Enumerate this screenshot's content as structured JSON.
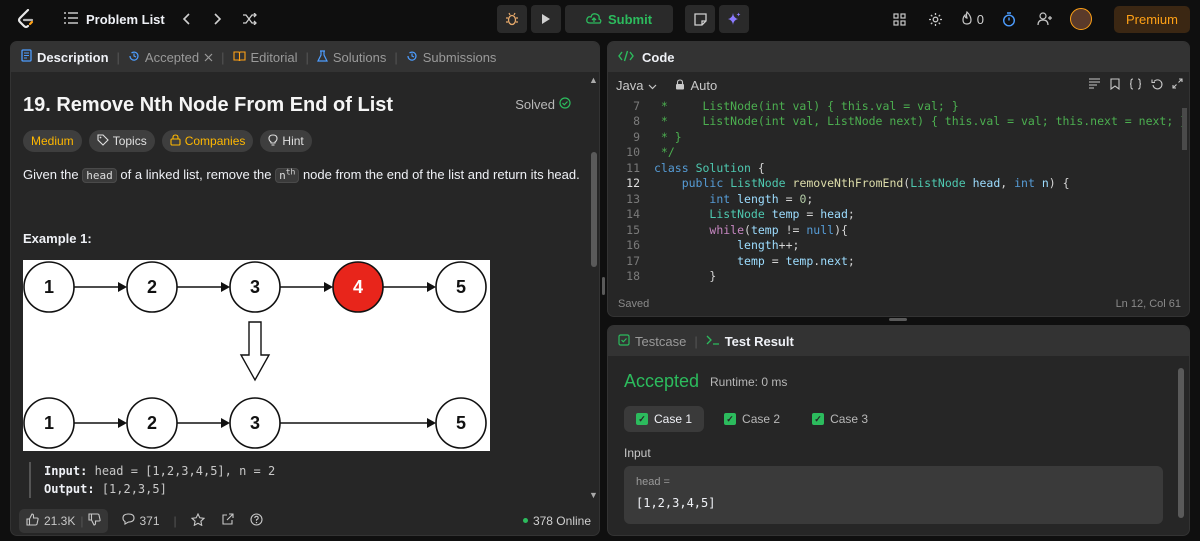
{
  "topbar": {
    "title": "Problem List",
    "submit_label": "Submit",
    "streak_count": "0",
    "premium_label": "Premium"
  },
  "left": {
    "tabs": [
      {
        "label": "Description"
      },
      {
        "label": "Accepted"
      },
      {
        "label": "Editorial"
      },
      {
        "label": "Solutions"
      },
      {
        "label": "Submissions"
      }
    ],
    "problem_title": "19. Remove Nth Node From End of List",
    "solved_label": "Solved",
    "tags": {
      "difficulty": "Medium",
      "topics": "Topics",
      "companies": "Companies",
      "hint": "Hint"
    },
    "desc": {
      "p1": "Given the",
      "code1": "head",
      "p2": "of a linked list, remove the",
      "n": "n",
      "sup": "th",
      "p3": "node from the end of the list and return its head."
    },
    "example_title": "Example 1:",
    "diagram": {
      "top_nodes": [
        "1",
        "2",
        "3",
        "4",
        "5"
      ],
      "bottom_nodes": [
        "1",
        "2",
        "3",
        "5"
      ],
      "highlight_color": "#e8251b"
    },
    "example": {
      "input_label": "Input:",
      "input_value": "head = [1,2,3,4,5], n = 2",
      "output_label": "Output:",
      "output_value": "[1,2,3,5]"
    },
    "footer": {
      "likes": "21.3K",
      "comments": "371",
      "online": "378 Online"
    }
  },
  "code": {
    "title": "Code",
    "language": "Java",
    "mode": "Auto",
    "lines": [
      {
        "n": "7",
        "text": " *     ListNode(int val) { this.val = val; }",
        "cls": "cmt"
      },
      {
        "n": "8",
        "text": " *     ListNode(int val, ListNode next) { this.val = val; this.next = next; }",
        "cls": "cmt"
      },
      {
        "n": "9",
        "text": " * }",
        "cls": "cmt"
      },
      {
        "n": "10",
        "text": " */",
        "cls": "cmt"
      },
      {
        "n": "11",
        "text": "class Solution {",
        "cls": "mix1"
      },
      {
        "n": "12",
        "text": "    public ListNode removeNthFromEnd(ListNode head, int n) {",
        "cls": "mix2"
      },
      {
        "n": "13",
        "text": "        int length = 0;",
        "cls": "mix3"
      },
      {
        "n": "14",
        "text": "        ListNode temp = head;",
        "cls": "mix4"
      },
      {
        "n": "15",
        "text": "        while(temp != null){",
        "cls": "mix5"
      },
      {
        "n": "16",
        "text": "            length++;",
        "cls": "pl"
      },
      {
        "n": "17",
        "text": "            temp = temp.next;",
        "cls": "mix7"
      },
      {
        "n": "18",
        "text": "        }",
        "cls": "pl"
      }
    ],
    "status": "Saved",
    "cursor": "Ln 12, Col 61"
  },
  "result": {
    "tabs": [
      {
        "label": "Testcase"
      },
      {
        "label": "Test Result"
      }
    ],
    "verdict": "Accepted",
    "runtime": "Runtime: 0 ms",
    "cases": [
      "Case 1",
      "Case 2",
      "Case 3"
    ],
    "input_label": "Input",
    "input_var": "head =",
    "input_value": "[1,2,3,4,5]"
  },
  "colors": {
    "accent": "#ffa116",
    "success": "#2cbb5d",
    "panel": "#262626"
  }
}
